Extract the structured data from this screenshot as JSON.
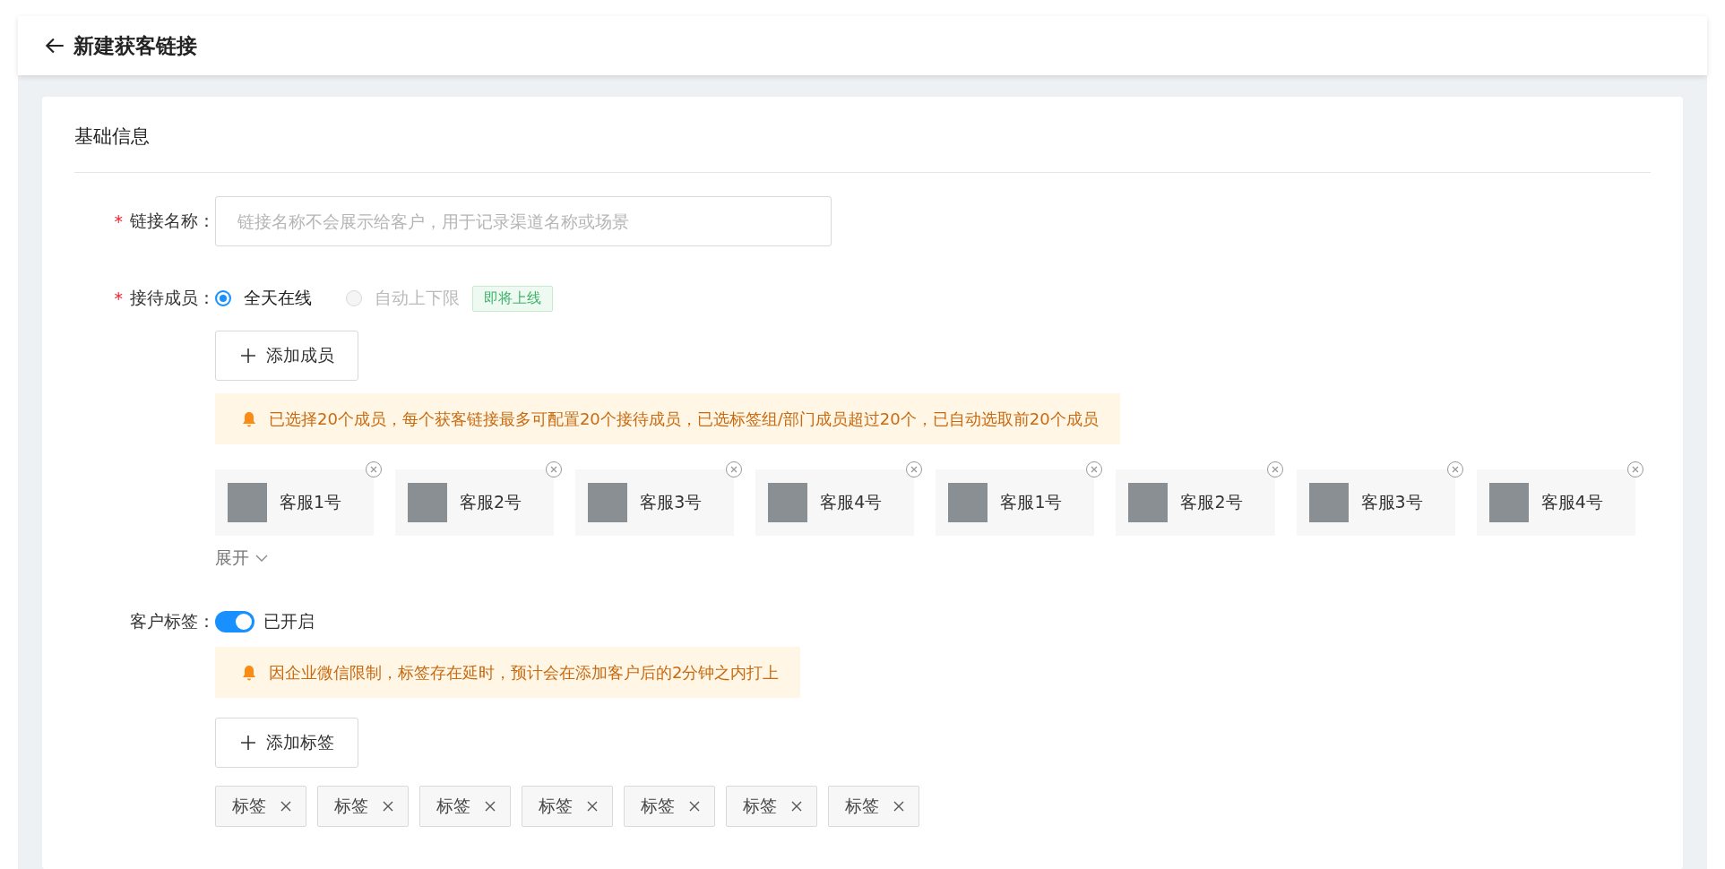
{
  "header": {
    "title": "新建获客链接"
  },
  "section": {
    "title": "基础信息"
  },
  "link_name": {
    "label": "链接名称：",
    "required_mark": "*",
    "placeholder": "链接名称不会展示给客户，用于记录渠道名称或场景"
  },
  "members": {
    "label": "接待成员：",
    "required_mark": "*",
    "options": [
      {
        "label": "全天在线",
        "selected": true,
        "disabled": false
      },
      {
        "label": "自动上下限",
        "selected": false,
        "disabled": true,
        "badge": "即将上线"
      }
    ],
    "add_button": "添加成员",
    "notice": "已选择20个成员，每个获客链接最多可配置20个接待成员，已选标签组/部门成员超过20个，已自动选取前20个成员",
    "chips": [
      {
        "name": "客服1号"
      },
      {
        "name": "客服2号"
      },
      {
        "name": "客服3号"
      },
      {
        "name": "客服4号"
      },
      {
        "name": "客服1号"
      },
      {
        "name": "客服2号"
      },
      {
        "name": "客服3号"
      },
      {
        "name": "客服4号"
      }
    ],
    "expand": "展开"
  },
  "customer_tags": {
    "label": "客户标签：",
    "on": true,
    "status": "已开启",
    "notice": "因企业微信限制，标签存在延时，预计会在添加客户后的2分钟之内打上",
    "add_button": "添加标签",
    "tags": [
      "标签",
      "标签",
      "标签",
      "标签",
      "标签",
      "标签",
      "标签"
    ]
  }
}
